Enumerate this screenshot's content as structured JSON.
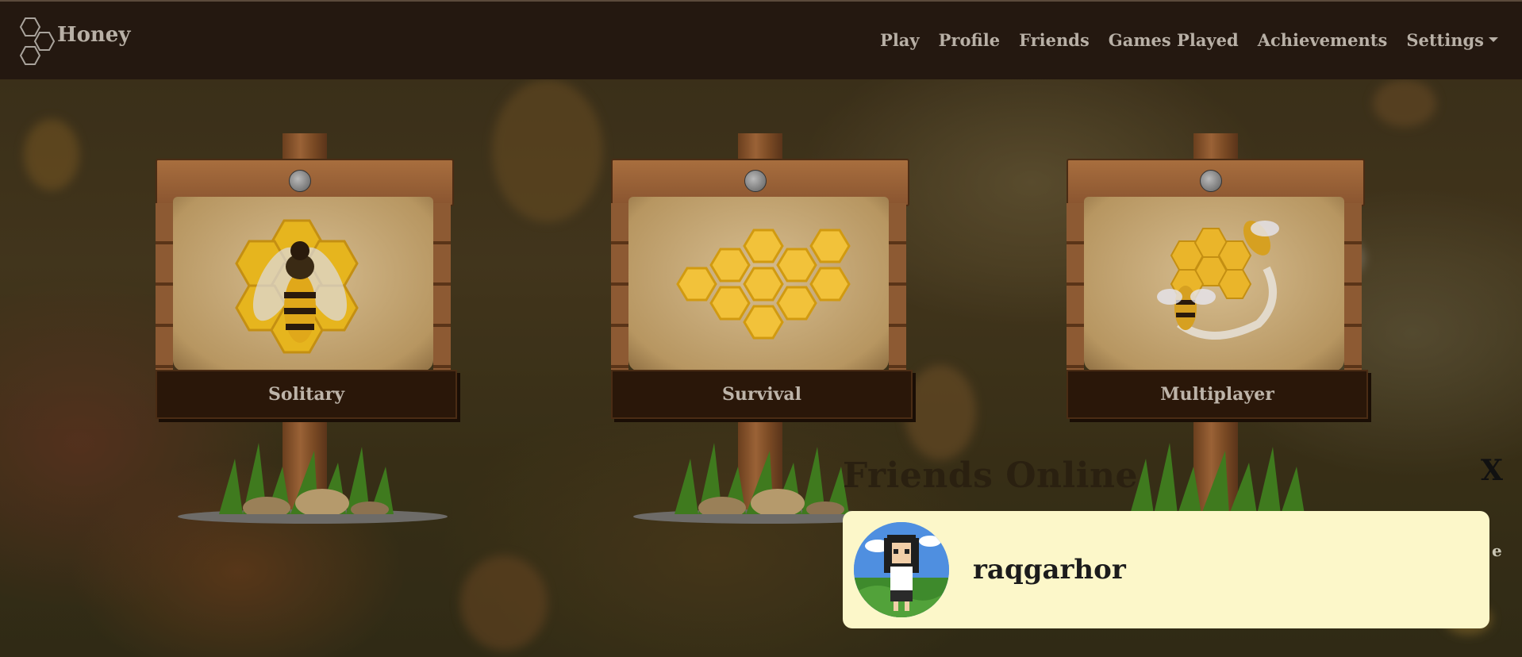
{
  "navbar": {
    "brand": "Honey",
    "items": [
      "Play",
      "Profile",
      "Friends",
      "Games Played",
      "Achievements",
      "Settings"
    ]
  },
  "game_modes": [
    {
      "label": "Solitary"
    },
    {
      "label": "Survival"
    },
    {
      "label": "Multiplayer"
    }
  ],
  "friends_panel": {
    "title": "Friends Online",
    "close_label": "X",
    "friends": [
      {
        "username": "raqgarhor"
      }
    ],
    "partial_text": "e"
  },
  "colors": {
    "navbar_bg": "#241810",
    "nav_text": "#b8b0a6",
    "friend_card_bg": "#fcf7c9",
    "sign_label_bg": "#2a1709"
  }
}
